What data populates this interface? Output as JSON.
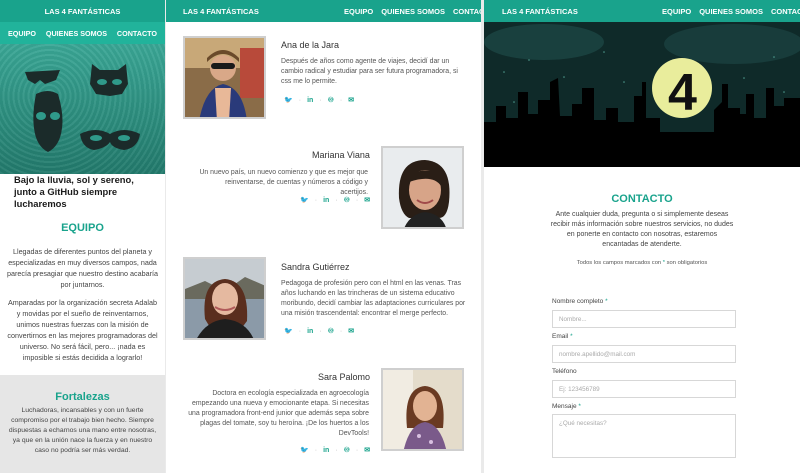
{
  "brand": "LAS 4 FANTÁSTICAS",
  "nav": {
    "equipo": "EQUIPO",
    "quienes": "QUIENES SOMOS",
    "contacto": "CONTACTO"
  },
  "hero_caption": "Bajo la lluvia, sol y sereno, junto a GitHub siempre lucharemos",
  "equipo": {
    "title": "EQUIPO",
    "p1": "Llegadas de diferentes puntos del planeta y especializadas en muy diversos campos, nada parecía presagiar que nuestro destino acabaría por juntarnos.",
    "p2": "Amparadas por la organización secreta Adalab y movidas por el sueño de reinventarnos, unimos nuestras fuerzas con la misión de convertirnos en las mejores programadoras del universo. No será fácil, pero... ¡nada es imposible si estás decidida a lograrlo!"
  },
  "fortalezas": {
    "title": "Fortalezas",
    "text": "Luchadoras, incansables y con un fuerte compromiso por el trabajo bien hecho. Siempre dispuestas a echarnos una mano entre nosotras, ya que en la unión nace la fuerza y en nuestro caso no podría ser más verdad."
  },
  "members": [
    {
      "name": "Ana de la Jara",
      "bio": "Después de años como agente de viajes, decidí dar un cambio radical y estudiar para ser futura programadora, si css me lo permite."
    },
    {
      "name": "Mariana Viana",
      "bio": "Un nuevo país, un nuevo comienzo y que es mejor que reinventarse, de cuentas y números a código y acertijos."
    },
    {
      "name": "Sandra Gutiérrez",
      "bio": "Pedagoga de profesión pero con el html en las venas. Tras años luchando en las trincheras de un sistema educativo moribundo, decidí cambiar las adaptaciones curriculares por una misión trascendental: encontrar el merge perfecto."
    },
    {
      "name": "Sara Palomo",
      "bio": "Doctora en ecología especializada en agroecología empezando una nueva y emocionante etapa. Si necesitas una programadora front-end junior que además sepa sobre plagas del tomate, soy tu heroína. ¡De los huertos a los DevTools!"
    }
  ],
  "social_icons": [
    "twitter-icon",
    "linkedin-icon",
    "github-icon",
    "email-icon"
  ],
  "social_glyphs": {
    "twitter": "🐦",
    "linkedin": "in",
    "github": "♾",
    "email": "✉"
  },
  "hero_badge": "4",
  "contacto": {
    "title": "CONTACTO",
    "intro": "Ante cualquier duda, pregunta o si simplemente deseas recibir más información sobre nuestros servicios, no dudes en ponerte en contacto con nosotras, estaremos encantadas de atenderte.",
    "required_note_before": "Todos los campos marcados con",
    "required_mark": "*",
    "required_note_after": "son obligatorios",
    "fields": [
      {
        "label": "Nombre completo",
        "required": "*",
        "placeholder": "Nombre..."
      },
      {
        "label": "Email",
        "required": "*",
        "placeholder": "nombre.apellido@mail.com"
      },
      {
        "label": "Teléfono",
        "required": "",
        "placeholder": "Ej: 123456789"
      },
      {
        "label": "Mensaje",
        "required": "*",
        "placeholder": "¿Qué necesitas?"
      }
    ]
  },
  "colors": {
    "accent": "#19a38c",
    "header": "#19a38c",
    "grey_box": "#e6e6e6"
  }
}
